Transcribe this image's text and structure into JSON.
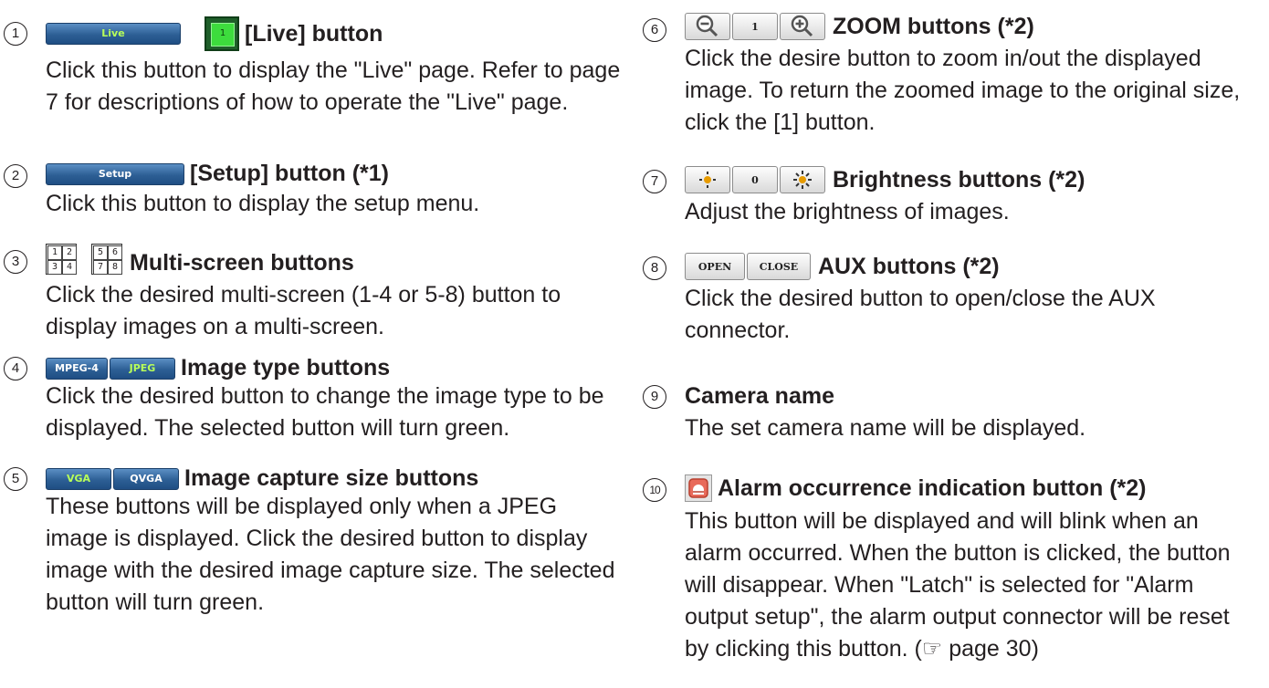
{
  "items": [
    {
      "num": "1",
      "btn_live": "Live",
      "btn_live_green": "1",
      "title": "[Live] button",
      "body": "Click this button to display the \"Live\" page. Refer to page 7 for descriptions of how to operate the \"Live\" page."
    },
    {
      "num": "2",
      "btn_setup": "Setup",
      "title": "[Setup] button (*1)",
      "body": "Click this button to display the setup menu."
    },
    {
      "num": "3",
      "grid1": [
        "1",
        "2",
        "3",
        "4"
      ],
      "grid2": [
        "5",
        "6",
        "7",
        "8"
      ],
      "title": "Multi-screen buttons",
      "body": "Click the desired multi-screen (1-4 or 5-8) button to display images on a multi-screen."
    },
    {
      "num": "4",
      "btn_a": "MPEG-4",
      "btn_b": "JPEG",
      "title": "Image type buttons",
      "body": "Click the desired button to change the image type to be displayed. The selected button will turn green."
    },
    {
      "num": "5",
      "btn_a": "VGA",
      "btn_b": "QVGA",
      "title": "Image capture size buttons",
      "body": "These buttons will be displayed only when a JPEG image is displayed. Click the desired button to display image with the desired image capture size. The selected button will turn green."
    },
    {
      "num": "6",
      "btn_mid": "1",
      "title": "ZOOM buttons (*2)",
      "body": "Click the desire button to zoom in/out the displayed image. To return the zoomed image to the original size, click the [1] button."
    },
    {
      "num": "7",
      "btn_mid": "0",
      "title": "Brightness buttons (*2)",
      "body": "Adjust the brightness of images."
    },
    {
      "num": "8",
      "btn_a": "OPEN",
      "btn_b": "CLOSE",
      "title": "AUX buttons (*2)",
      "body": "Click the desired button to open/close the AUX connector."
    },
    {
      "num": "9",
      "title": "Camera name",
      "body": "The set camera name will be displayed."
    },
    {
      "num": "10",
      "title": "Alarm occurrence indication button (*2)",
      "body": "This button will be displayed and will blink when an alarm occurred. When the button is clicked, the button will disappear. When \"Latch\" is selected for \"Alarm output setup\", the alarm output connector will be reset by clicking this button. (☞ page 30)"
    }
  ]
}
